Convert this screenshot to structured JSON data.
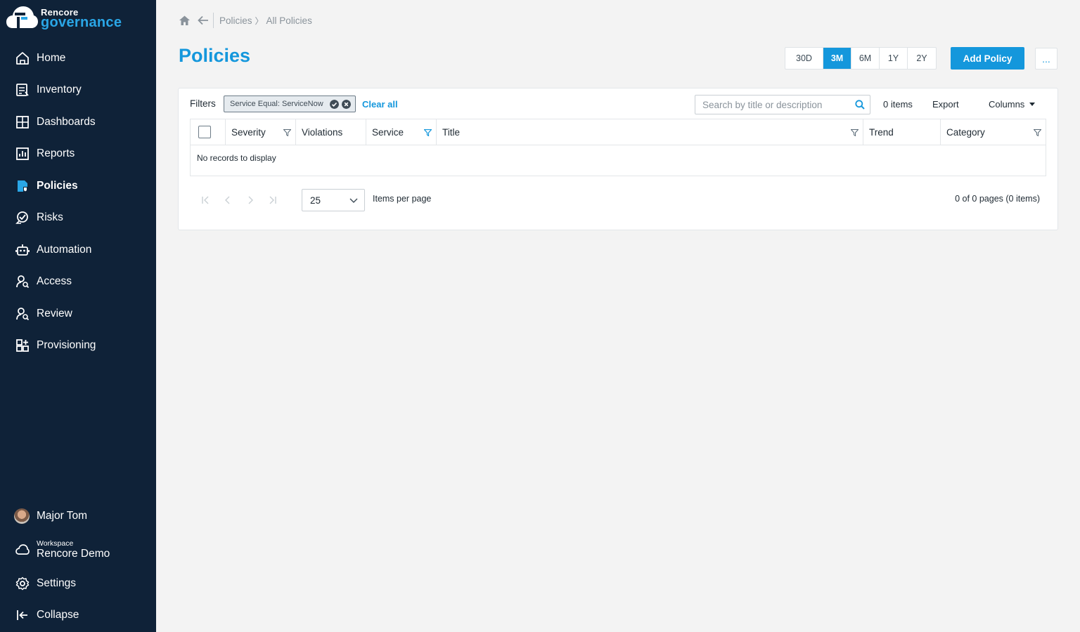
{
  "brand": {
    "top": "Rencore",
    "bottom": "governance"
  },
  "nav": [
    {
      "label": "Home",
      "icon": "home-icon"
    },
    {
      "label": "Inventory",
      "icon": "inventory-icon"
    },
    {
      "label": "Dashboards",
      "icon": "dashboards-icon"
    },
    {
      "label": "Reports",
      "icon": "reports-icon"
    },
    {
      "label": "Policies",
      "icon": "policies-icon",
      "active": true
    },
    {
      "label": "Risks",
      "icon": "risks-icon"
    },
    {
      "label": "Automation",
      "icon": "automation-icon"
    },
    {
      "label": "Access",
      "icon": "access-icon"
    },
    {
      "label": "Review",
      "icon": "review-icon"
    },
    {
      "label": "Provisioning",
      "icon": "provisioning-icon"
    }
  ],
  "user": {
    "name": "Major Tom"
  },
  "workspace": {
    "caption": "Workspace",
    "name": "Rencore Demo"
  },
  "bottom": {
    "settings": "Settings",
    "collapse": "Collapse"
  },
  "breadcrumb": {
    "parent": "Policies",
    "current": "All Policies"
  },
  "page": {
    "title": "Policies"
  },
  "ranges": [
    "30D",
    "3M",
    "6M",
    "1Y",
    "2Y"
  ],
  "selected_range": "3M",
  "actions": {
    "add": "Add Policy",
    "more": "..."
  },
  "filters": {
    "label": "Filters",
    "chip": "Service Equal: ServiceNow",
    "clear": "Clear all"
  },
  "toolbar": {
    "search_placeholder": "Search by title or description",
    "count": "0 items",
    "export": "Export",
    "columns": "Columns"
  },
  "table": {
    "columns": [
      "Severity",
      "Violations",
      "Service",
      "Title",
      "Trend",
      "Category"
    ],
    "empty": "No records to display"
  },
  "pager": {
    "page_size": "25",
    "page_size_label": "Items per page",
    "info": "0 of 0 pages (0 items)"
  },
  "colors": {
    "sidebar": "#0f2238",
    "accent": "#1497dc",
    "background": "#f3f3f3"
  }
}
